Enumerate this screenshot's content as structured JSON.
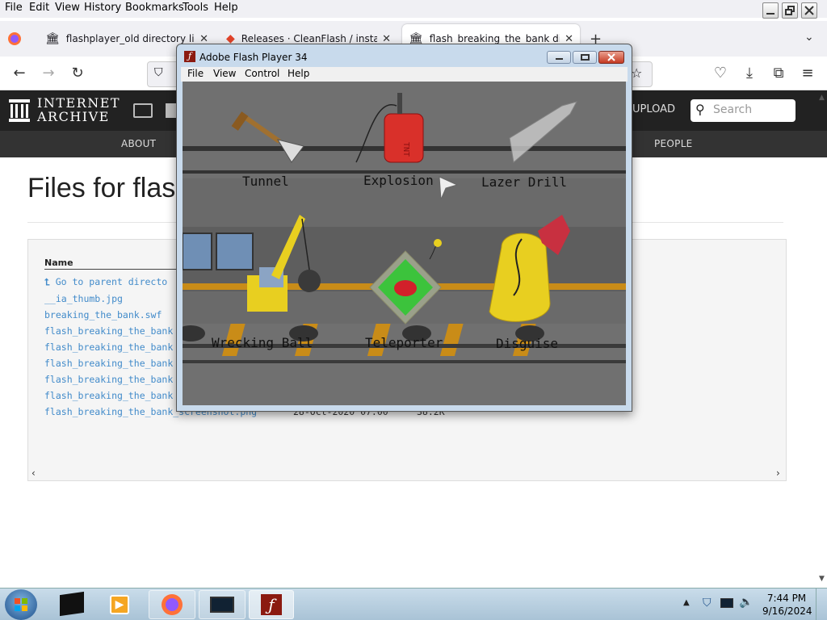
{
  "menubar": {
    "items": [
      "File",
      "Edit",
      "View",
      "History",
      "Bookmarks",
      "Tools",
      "Help"
    ]
  },
  "tabs": [
    {
      "title": "flashplayer_old directory listing"
    },
    {
      "title": "Releases · CleanFlash / installer"
    },
    {
      "title": "flash_breaking_the_bank directory"
    }
  ],
  "ia": {
    "logo_line1": "INTERNET",
    "logo_line2": "ARCHIVE",
    "upload": "UPLOAD",
    "search_placeholder": "Search",
    "nav": [
      "ABOUT",
      "PEOPLE"
    ]
  },
  "page": {
    "title": "Files for flas",
    "column_name": "Name",
    "files": [
      {
        "name": "Go to parent directo",
        "date": "",
        "size": ""
      },
      {
        "name": "__ia_thumb.jpg",
        "date": "",
        "size": ""
      },
      {
        "name": "breaking_the_bank.swf",
        "date": "",
        "size": ""
      },
      {
        "name": "flash_breaking_the_bank",
        "date": "",
        "size": ""
      },
      {
        "name": "flash_breaking_the_bank",
        "date": "",
        "size": ""
      },
      {
        "name": "flash_breaking_the_bank",
        "date": "",
        "size": ""
      },
      {
        "name": "flash_breaking_the_bank",
        "date": "",
        "size": ""
      },
      {
        "name": "flash_breaking_the_bank",
        "date": "",
        "size": ""
      },
      {
        "name": "flash_breaking_the_bank_screenshot.png",
        "date": "28-Oct-2020 07:00",
        "size": "38.2K"
      }
    ]
  },
  "flash": {
    "title": "Adobe Flash Player 34",
    "menu": [
      "File",
      "View",
      "Control",
      "Help"
    ],
    "tnt_label": "TNT",
    "tools": [
      "Tunnel",
      "Explosion",
      "Lazer Drill",
      "Wrecking Ball",
      "Teleporter",
      "Disguise"
    ]
  },
  "taskbar": {
    "time": "7:44 PM",
    "date": "9/16/2024"
  }
}
